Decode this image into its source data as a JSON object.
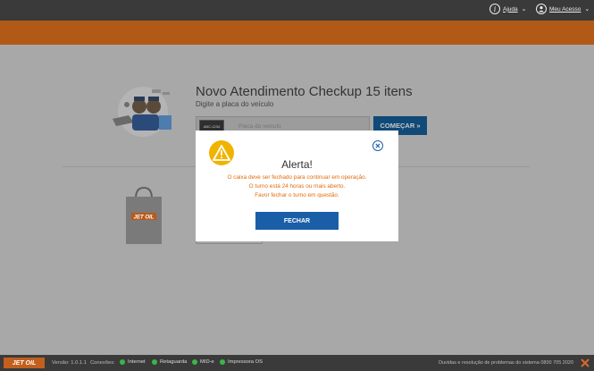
{
  "header": {
    "help_label": "Ajuda",
    "access_label": "Meu Acesso"
  },
  "main": {
    "title": "Novo Atendimento Checkup 15 itens",
    "subtitle": "Digite a placa do veículo",
    "plate_tag": "ABC-1234",
    "plate_placeholder": "Placa do veículo",
    "start_label": "COMEÇAR »"
  },
  "alert": {
    "title": "Alerta!",
    "lines": [
      "O caixa deve ser fechado para continuar em operação.",
      "O turno está 24 horas ou mais aberto.",
      "Favor fechar o turno em questão."
    ],
    "close_button": "FECHAR"
  },
  "bag": {
    "logo_text": "JET OIL"
  },
  "footer": {
    "logo_text": "JET OIL",
    "version": "Versão: 1.0.1.1",
    "connections_label": "Conexões:",
    "connections": [
      "Internet",
      "Retaguarda",
      "MID-e",
      "Impressora OS"
    ],
    "support": "Duvidas e resolução de problemas do sistema 0800 705 2020"
  },
  "colors": {
    "orange_bar": "#b15a18",
    "primary_blue": "#1b5ea8",
    "alert_text": "#e26b0a",
    "warning_yellow": "#f0b400",
    "status_green": "#3ab54a"
  }
}
